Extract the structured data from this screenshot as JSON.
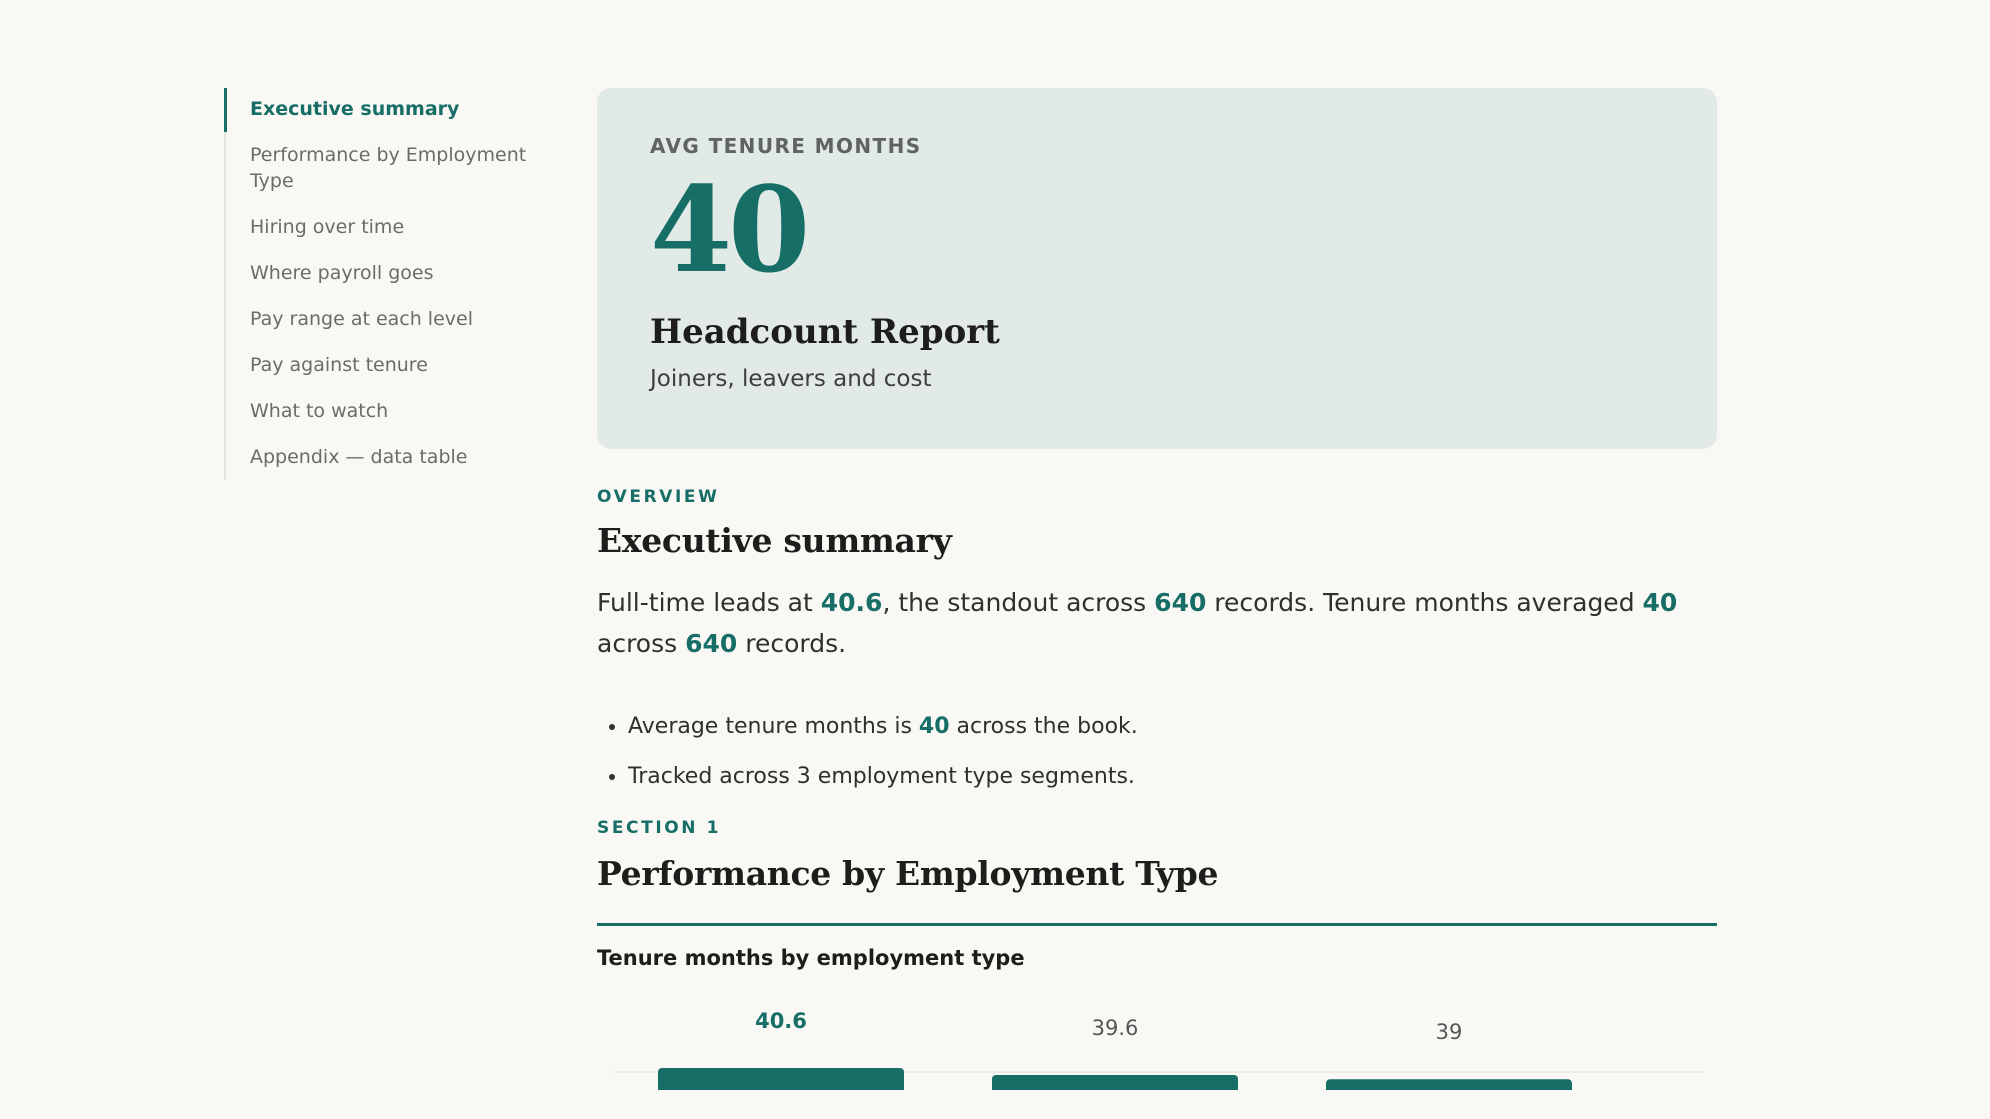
{
  "toc": [
    {
      "label": "Executive summary",
      "active": true
    },
    {
      "label": "Performance by Employment Type",
      "active": false
    },
    {
      "label": "Hiring over time",
      "active": false
    },
    {
      "label": "Where payroll goes",
      "active": false
    },
    {
      "label": "Pay range at each level",
      "active": false
    },
    {
      "label": "Pay against tenure",
      "active": false
    },
    {
      "label": "What to watch",
      "active": false
    },
    {
      "label": "Appendix — data table",
      "active": false
    }
  ],
  "hero": {
    "label": "AVG TENURE MONTHS",
    "value": "40",
    "title": "Headcount Report",
    "subtitle": "Joiners, leavers and cost"
  },
  "overview": {
    "eyebrow": "OVERVIEW",
    "title": "Executive summary",
    "summary": {
      "t1": "Full-time leads at ",
      "v1": "40.6",
      "t2": ", the standout across ",
      "v2": "640",
      "t3": " records. Tenure months averaged ",
      "v3": "40",
      "t4": " across ",
      "v4": "640",
      "t5": " records."
    },
    "bullets": {
      "b1_pre": "Average tenure months is ",
      "b1_val": "40",
      "b1_post": " across the book.",
      "b2": "Tracked across 3 employment type segments."
    }
  },
  "section1": {
    "eyebrow": "SECTION 1",
    "title": "Performance by Employment Type"
  },
  "colors": {
    "accent": "#176e66",
    "hero_bg": "#e1eae7",
    "page_bg": "#f9f8f5",
    "bar_muted": "#555555"
  },
  "chart_data": {
    "type": "bar",
    "title": "Tenure months by employment type",
    "values": [
      40.6,
      39.6,
      39
    ],
    "value_labels": [
      "40.6",
      "39.6",
      "39"
    ],
    "highlight_index": 0
  }
}
